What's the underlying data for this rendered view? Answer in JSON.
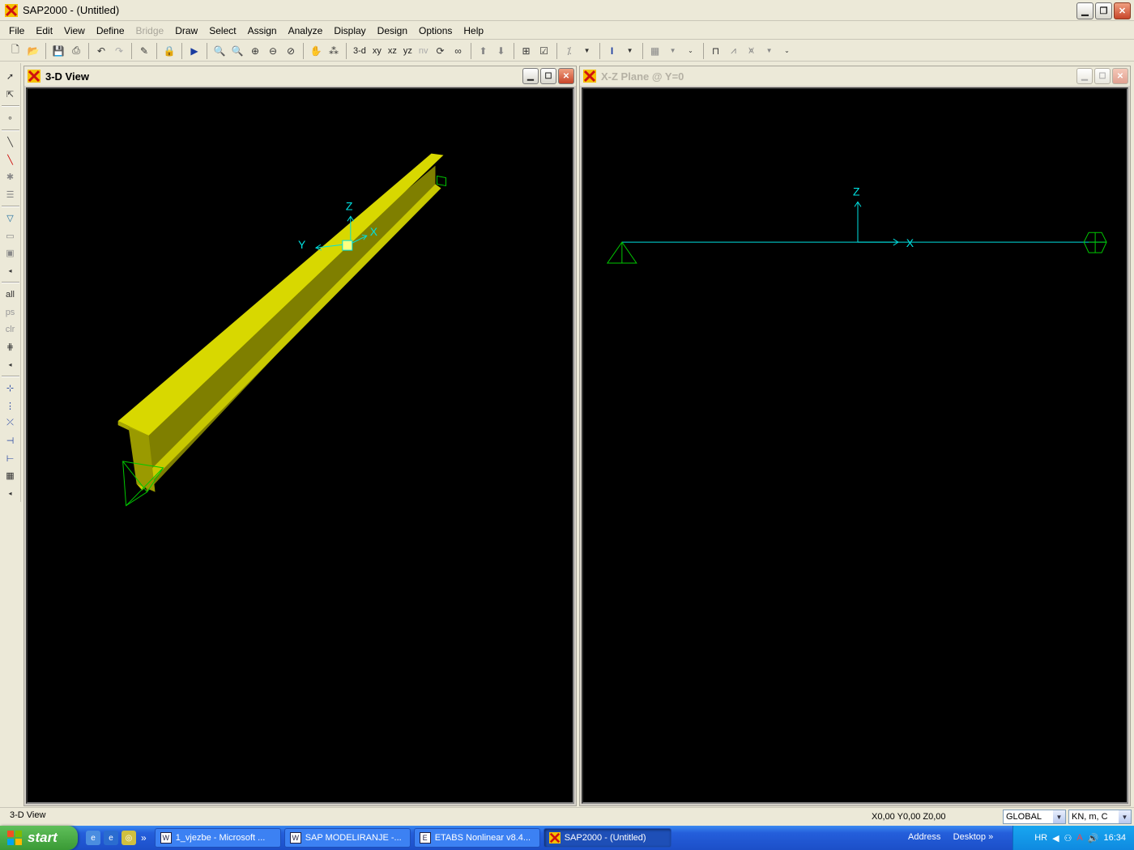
{
  "app": {
    "title": "SAP2000 - (Untitled)"
  },
  "menu": [
    "File",
    "Edit",
    "View",
    "Define",
    "Bridge",
    "Draw",
    "Select",
    "Assign",
    "Analyze",
    "Display",
    "Design",
    "Options",
    "Help"
  ],
  "menu_disabled": [
    "Bridge"
  ],
  "toolbar": {
    "view_3d": "3-d",
    "view_xy": "xy",
    "view_xz": "xz",
    "view_yz": "yz",
    "view_nv": "nv"
  },
  "left_toolbar": {
    "select_all": "all",
    "previous_selection": "ps",
    "clear_selection": "clr"
  },
  "windows": {
    "left": {
      "title": "3-D View",
      "axes": {
        "x": "X",
        "y": "Y",
        "z": "Z"
      }
    },
    "right": {
      "title": "X-Z Plane @ Y=0",
      "axes": {
        "x": "X",
        "z": "Z"
      }
    }
  },
  "status": {
    "view_name": "3-D View",
    "coordinates": "X0,00  Y0,00  Z0,00",
    "coord_system": "GLOBAL",
    "units": "KN, m, C"
  },
  "taskbar": {
    "start_label": "start",
    "tasks": [
      {
        "label": "1_vjezbe - Microsoft ...",
        "icon": "word-icon",
        "active": false
      },
      {
        "label": "SAP  MODELIRANJE -...",
        "icon": "word-icon",
        "active": false
      },
      {
        "label": "ETABS Nonlinear v8.4...",
        "icon": "etabs-icon",
        "active": false
      },
      {
        "label": "SAP2000 - (Untitled)",
        "icon": "sap-icon",
        "active": true
      }
    ],
    "address_label": "Address",
    "desktop_label": "Desktop",
    "language": "HR",
    "clock": "16:34"
  },
  "colors": {
    "beam_top": "#d8d800",
    "beam_web": "#7f7f00",
    "support": "#00c800",
    "axes": "#00e0e0",
    "canvas_bg": "#000000"
  }
}
